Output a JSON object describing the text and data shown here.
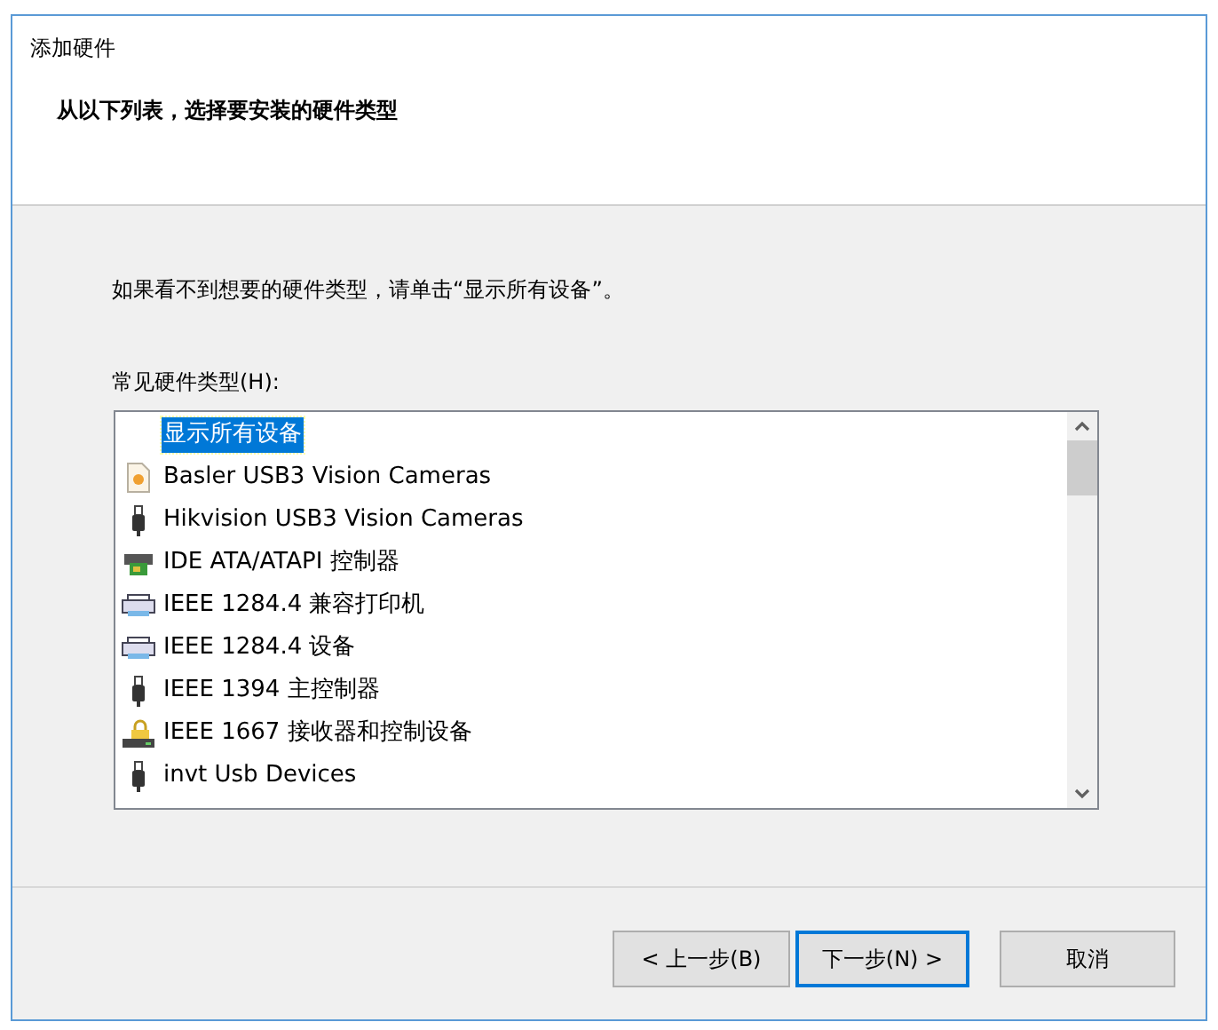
{
  "window": {
    "title": "添加硬件"
  },
  "header": {
    "heading": "从以下列表，选择要安装的硬件类型"
  },
  "instruction": "如果看不到想要的硬件类型，请单击“显示所有设备”。",
  "list": {
    "label": "常见硬件类型(H):",
    "items": [
      {
        "label": "显示所有设备",
        "kind": "none",
        "selected": true
      },
      {
        "label": "Basler USB3 Vision Cameras",
        "kind": "document",
        "selected": false
      },
      {
        "label": "Hikvision USB3 Vision Cameras",
        "kind": "usb",
        "selected": false
      },
      {
        "label": "IDE ATA/ATAPI 控制器",
        "kind": "controller",
        "selected": false
      },
      {
        "label": "IEEE 1284.4 兼容打印机",
        "kind": "printer",
        "selected": false
      },
      {
        "label": "IEEE 1284.4 设备",
        "kind": "printer",
        "selected": false
      },
      {
        "label": "IEEE 1394 主控制器",
        "kind": "usb",
        "selected": false
      },
      {
        "label": "IEEE 1667 接收器和控制设备",
        "kind": "lock",
        "selected": false
      },
      {
        "label": "invt Usb Devices",
        "kind": "usb",
        "selected": false
      }
    ]
  },
  "buttons": [
    {
      "label": "< 上一步(B)",
      "selected": false
    },
    {
      "label": "下一步(N) >",
      "selected": true
    },
    {
      "label": "取消",
      "selected": false
    }
  ]
}
